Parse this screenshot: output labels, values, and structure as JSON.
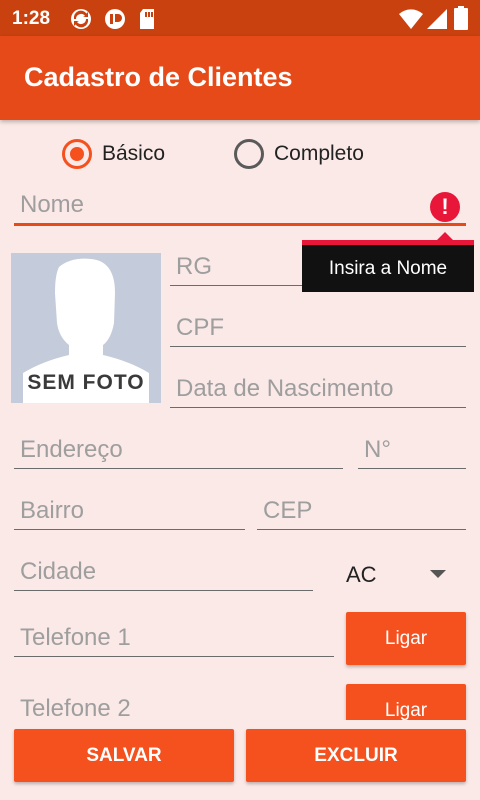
{
  "status_bar": {
    "time": "1:28"
  },
  "app_bar": {
    "title": "Cadastro de Clientes"
  },
  "mode": {
    "options": [
      "Básico",
      "Completo"
    ],
    "selected": "Básico"
  },
  "form": {
    "nome": {
      "placeholder": "Nome",
      "error": "Insira a Nome"
    },
    "rg": {
      "placeholder": "RG"
    },
    "cpf": {
      "placeholder": "CPF"
    },
    "nascimento": {
      "placeholder": "Data de Nascimento"
    },
    "endereco": {
      "placeholder": "Endereço"
    },
    "numero": {
      "placeholder": "N°"
    },
    "bairro": {
      "placeholder": "Bairro"
    },
    "cep": {
      "placeholder": "CEP"
    },
    "cidade": {
      "placeholder": "Cidade"
    },
    "estado": {
      "selected": "AC"
    },
    "telefone1": {
      "placeholder": "Telefone 1",
      "button": "Ligar"
    },
    "telefone2": {
      "placeholder": "Telefone 2",
      "button": "Ligar"
    }
  },
  "photo": {
    "label": "SEM FOTO"
  },
  "actions": {
    "save": "SALVAR",
    "delete": "EXCLUIR"
  },
  "colors": {
    "status_bar": "#c9410e",
    "app_bar": "#e64a19",
    "accent": "#f4511e",
    "error": "#e8173a",
    "background": "#fbe9e7"
  }
}
